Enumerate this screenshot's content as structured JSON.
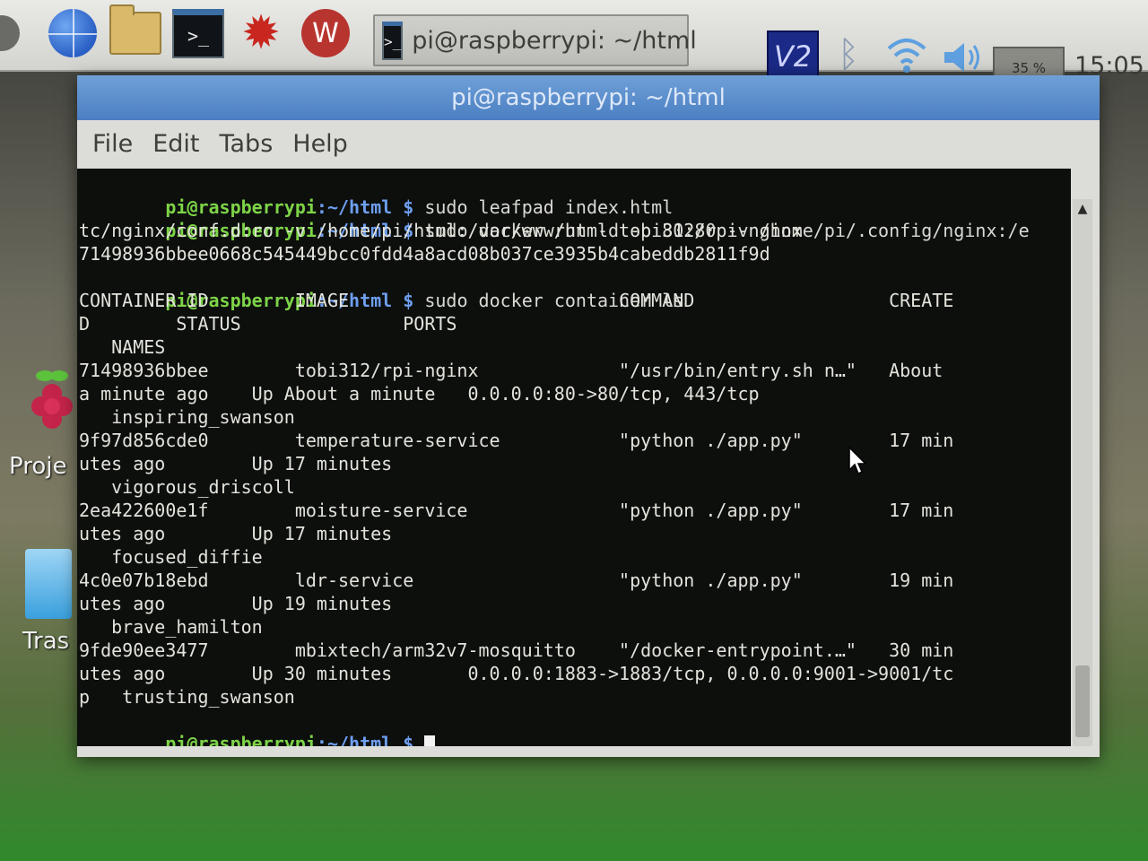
{
  "taskbar": {
    "task_button_label": "pi@raspberrypi: ~/html",
    "terminal_glyph": ">_",
    "vnc_label": "V2",
    "cpu_meter": "35 %",
    "clock": "15:05"
  },
  "desktop": {
    "projects_label": "Proje",
    "trash_label": "Tras"
  },
  "window": {
    "title": "pi@raspberrypi: ~/html",
    "menu": [
      "File",
      "Edit",
      "Tabs",
      "Help"
    ]
  },
  "terminal": {
    "prompt_user": "pi@raspberrypi",
    "prompt_path": ":~/html $",
    "lines": {
      "l1_cmd": " sudo leafpad index.html",
      "l2_cmd": " sudo docker run -d -p 80:80 -v /home/pi/.config/nginx:/e",
      "l3": "tc/nginx/conf.d:ro -v /home/pi/html:/var/www/html tobi312/rpi-nginx",
      "l4": "71498936bbee0668c545449bcc0fdd4a8acd08b037ce3935b4cabeddb2811f9d",
      "l5_cmd": " sudo docker container ls",
      "l6": "CONTAINER ID        IMAGE                         COMMAND                  CREATE",
      "l7": "D        STATUS               PORTS",
      "l8": "   NAMES",
      "l9": "71498936bbee        tobi312/rpi-nginx             \"/usr/bin/entry.sh n…\"   About",
      "l10": "a minute ago    Up About a minute   0.0.0.0:80->80/tcp, 443/tcp",
      "l11": "   inspiring_swanson",
      "l12": "9f97d856cde0        temperature-service           \"python ./app.py\"        17 min",
      "l13": "utes ago        Up 17 minutes",
      "l14": "   vigorous_driscoll",
      "l15": "2ea422600e1f        moisture-service              \"python ./app.py\"        17 min",
      "l16": "utes ago        Up 17 minutes",
      "l17": "   focused_diffie",
      "l18": "4c0e07b18ebd        ldr-service                   \"python ./app.py\"        19 min",
      "l19": "utes ago        Up 19 minutes",
      "l20": "   brave_hamilton",
      "l21": "9fde90ee3477        mbixtech/arm32v7-mosquitto    \"/docker-entrypoint.…\"   30 min",
      "l22": "utes ago        Up 30 minutes       0.0.0.0:1883->1883/tcp, 0.0.0.0:9001->9001/tc",
      "l23": "p   trusting_swanson"
    }
  },
  "colors": {
    "prompt_user": "#7dd447",
    "prompt_path": "#6e9ff0",
    "terminal_bg": "#0d0f0d",
    "titlebar": "#5a8ccb"
  }
}
